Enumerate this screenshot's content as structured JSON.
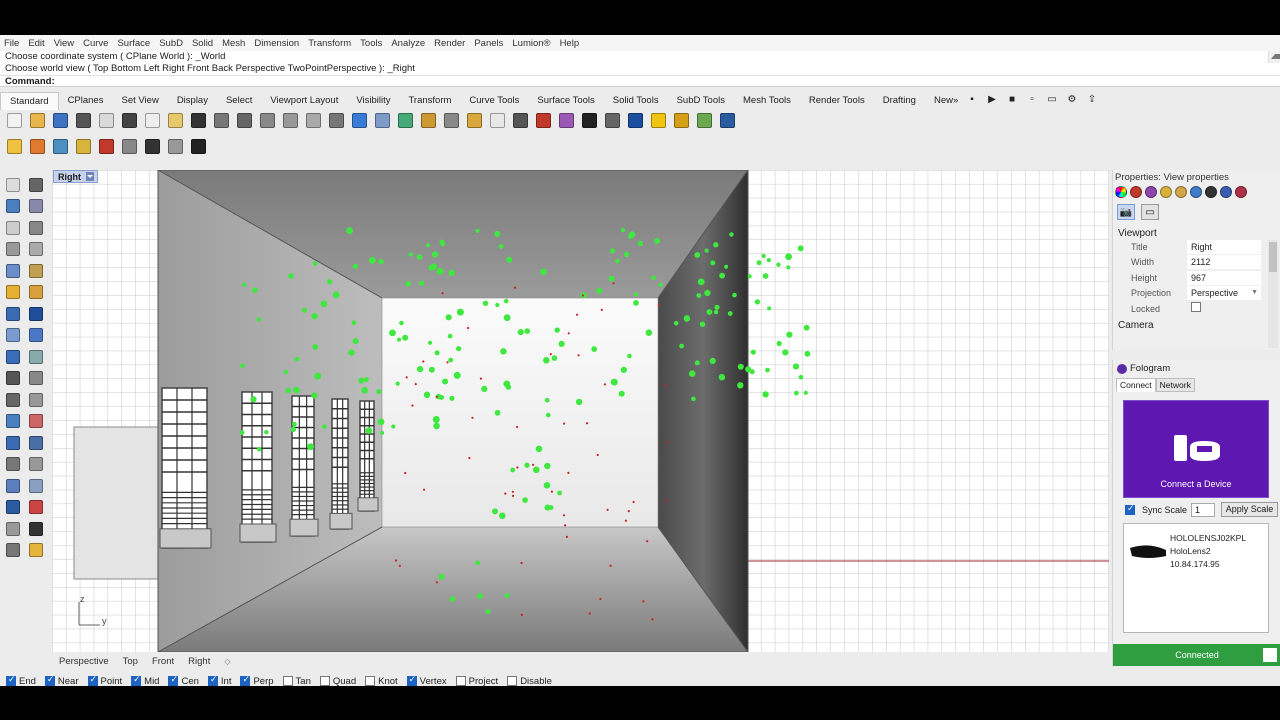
{
  "menu": [
    "File",
    "Edit",
    "View",
    "Curve",
    "Surface",
    "SubD",
    "Solid",
    "Mesh",
    "Dimension",
    "Transform",
    "Tools",
    "Analyze",
    "Render",
    "Panels",
    "Lumion®",
    "Help"
  ],
  "command_history": {
    "line1": "Choose coordinate system ( CPlane  World ): _World",
    "line2": "Choose world view ( Top  Bottom  Left  Right  Front  Back  Perspective  TwoPointPerspective ): _Right",
    "prompt": "Command:"
  },
  "toolbar_tabs": [
    "Standard",
    "CPlanes",
    "Set View",
    "Display",
    "Select",
    "Viewport Layout",
    "Visibility",
    "Transform",
    "Curve Tools",
    "Surface Tools",
    "Solid Tools",
    "SubD Tools",
    "Mesh Tools",
    "Render Tools",
    "Drafting",
    "New»"
  ],
  "active_tab": "Standard",
  "toolbar_icons_row1": [
    "new-file-icon",
    "open-file-icon",
    "save-icon",
    "print-icon",
    "import-icon",
    "cut-icon",
    "copy-icon",
    "paste-icon",
    "undo-icon",
    "pan-icon",
    "move-view-icon",
    "zoom-icon",
    "zoom-window-icon",
    "zoom-extents-icon",
    "zoom-selected-icon",
    "rotate-view-icon",
    "four-views-icon",
    "cplane-icon",
    "layer-icon",
    "visibility-icon",
    "select-filter-icon",
    "light-icon",
    "lock-icon",
    "material-icon",
    "color-wheel-icon",
    "shaded-sphere-icon",
    "rendered-sphere-icon",
    "ghost-sphere-icon",
    "settings-icon",
    "options-icon",
    "grasshopper-icon",
    "help-icon"
  ],
  "toolbar_icons_row2": [
    "hatch-icon",
    "block-icon",
    "analysis-icon",
    "lumion-icon",
    "surface-icon",
    "render-icon",
    "camera-icon",
    "subd-icon",
    "chart-bars-icon"
  ],
  "viewport": {
    "label": "Right",
    "axis_z": "z",
    "axis_y": "y",
    "tabs": [
      "Perspective",
      "Top",
      "Front",
      "Right"
    ]
  },
  "osnaps": [
    {
      "label": "End",
      "on": true
    },
    {
      "label": "Near",
      "on": true
    },
    {
      "label": "Point",
      "on": true
    },
    {
      "label": "Mid",
      "on": true
    },
    {
      "label": "Cen",
      "on": true
    },
    {
      "label": "Int",
      "on": true
    },
    {
      "label": "Perp",
      "on": true
    },
    {
      "label": "Tan",
      "on": false
    },
    {
      "label": "Quad",
      "on": false
    },
    {
      "label": "Knot",
      "on": false
    },
    {
      "label": "Vertex",
      "on": true
    },
    {
      "label": "Project",
      "on": false
    },
    {
      "label": "Disable",
      "on": false
    }
  ],
  "properties": {
    "title": "Properties: View properties",
    "section": "Viewport",
    "rows": [
      {
        "k": "Title",
        "v": "Right"
      },
      {
        "k": "Width",
        "v": "2112"
      },
      {
        "k": "Height",
        "v": "967"
      },
      {
        "k": "Projection",
        "v": "Perspective"
      },
      {
        "k": "Locked",
        "v": ""
      }
    ],
    "section2": "Camera"
  },
  "fologram": {
    "title": "Fologram",
    "tabs": [
      "Connect",
      "Network"
    ],
    "connect_label": "Connect a Device",
    "sync_label": "Sync Scale",
    "sync_value": "1",
    "apply_label": "Apply Scale",
    "device_name": "HOLOLENSJ02KPL",
    "device_type": "HoloLens2",
    "device_ip": "10.84.174.95",
    "status": "Connected"
  },
  "colors": {
    "accent_purple": "#5e17b0",
    "connected_green": "#2e9e41",
    "point_green": "#3fe83f",
    "point_red": "#cc2222",
    "viewport_label_bg": "#c7d3ec"
  }
}
